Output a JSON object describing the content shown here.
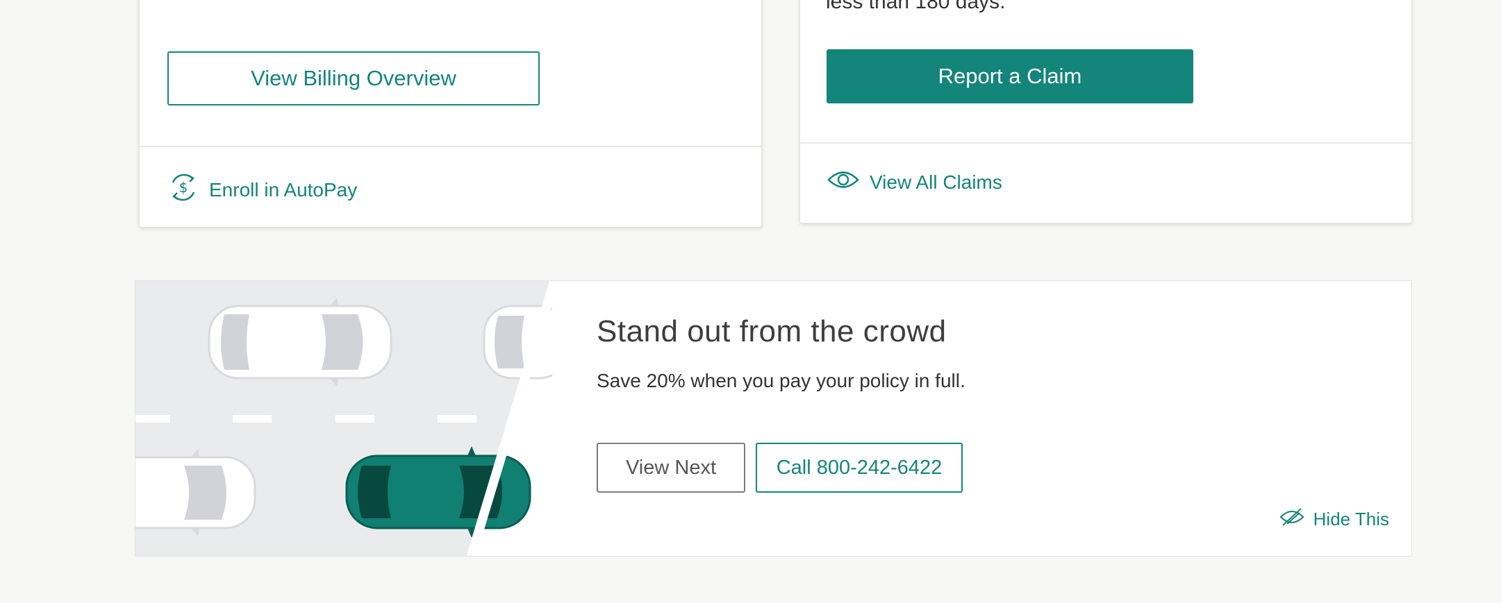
{
  "billing_card": {
    "view_billing_label": "View Billing Overview",
    "autopay_label": "Enroll in AutoPay"
  },
  "claims_card": {
    "partial_text": "less than 180 days.",
    "report_claim_label": "Report a Claim",
    "view_claims_label": "View All Claims"
  },
  "promo": {
    "title": "Stand out from the crowd",
    "subtitle": "Save 20% when you pay your policy in full.",
    "view_next_label": "View Next",
    "call_label": "Call 800-242-6422",
    "hide_label": "Hide This"
  },
  "colors": {
    "accent": "#13857a",
    "background": "#f7f7f5",
    "car_highlight": "#0f8072"
  },
  "icons": [
    "autopay-icon",
    "eye-icon",
    "eye-slash-icon"
  ]
}
